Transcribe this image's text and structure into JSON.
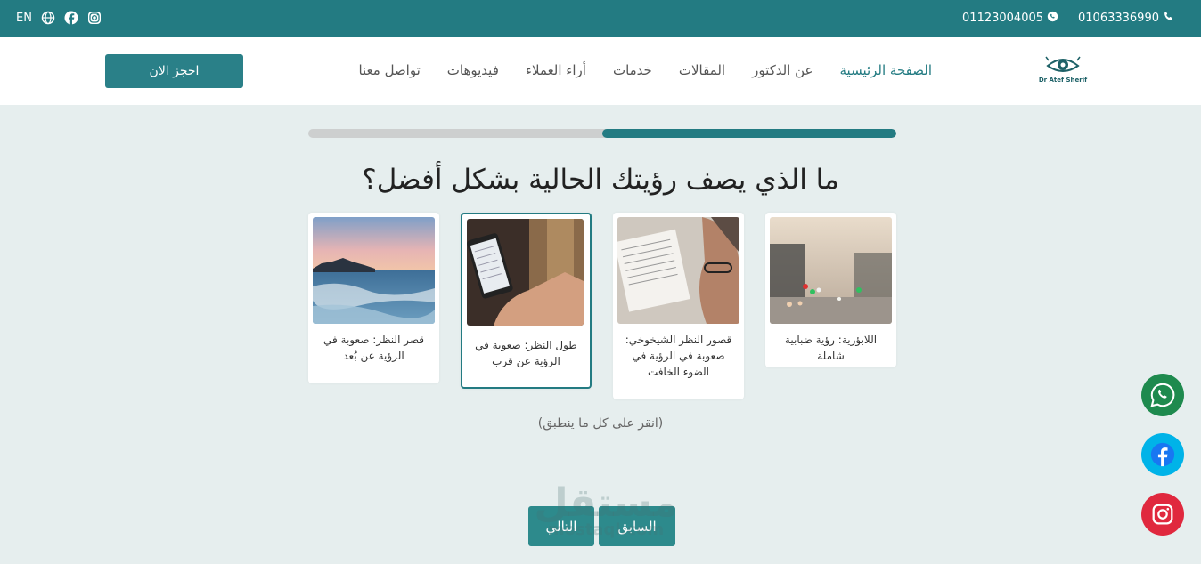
{
  "topbar": {
    "phone1": "01063336990",
    "phone2": "01123004005",
    "lang": "EN"
  },
  "nav": {
    "logo_text": "Dr Atef Sherif",
    "items": [
      {
        "label": "الصفحة الرئيسية",
        "active": true
      },
      {
        "label": "عن الدكتور"
      },
      {
        "label": "المقالات"
      },
      {
        "label": "خدمات"
      },
      {
        "label": "أراء العملاء"
      },
      {
        "label": "فيديوهات"
      },
      {
        "label": "تواصل معنا"
      }
    ],
    "book_label": "احجز الان"
  },
  "progress": {
    "value": 0.5
  },
  "question": "ما الذي يصف رؤيتك الحالية بشكل أفضل؟",
  "options": [
    {
      "caption": "اللابؤرية: رؤية ضبابية شاملة",
      "image": "blurry-city-lights",
      "selected": false
    },
    {
      "caption": "قصور النظر الشيخوخي: صعوبة في الرؤية في الضوء الخافت",
      "image": "man-reading-book",
      "selected": false
    },
    {
      "caption": "طول النظر: صعوبة في الرؤية عن قرب",
      "image": "hand-holding-phone",
      "selected": true
    },
    {
      "caption": "قصر النظر: صعوبة في الرؤية عن بُعد",
      "image": "sea-coast-sunset",
      "selected": false
    }
  ],
  "hint": "(انقر على كل ما ينطبق)",
  "buttons": {
    "next": "التالي",
    "prev": "السابق"
  },
  "watermark": {
    "main": "مستقل",
    "sub": "mostaql.com"
  },
  "colors": {
    "primary": "#237b82",
    "whatsapp": "#1e8a4e",
    "facebook": "#1877f2",
    "instagram": "#e0283e"
  }
}
